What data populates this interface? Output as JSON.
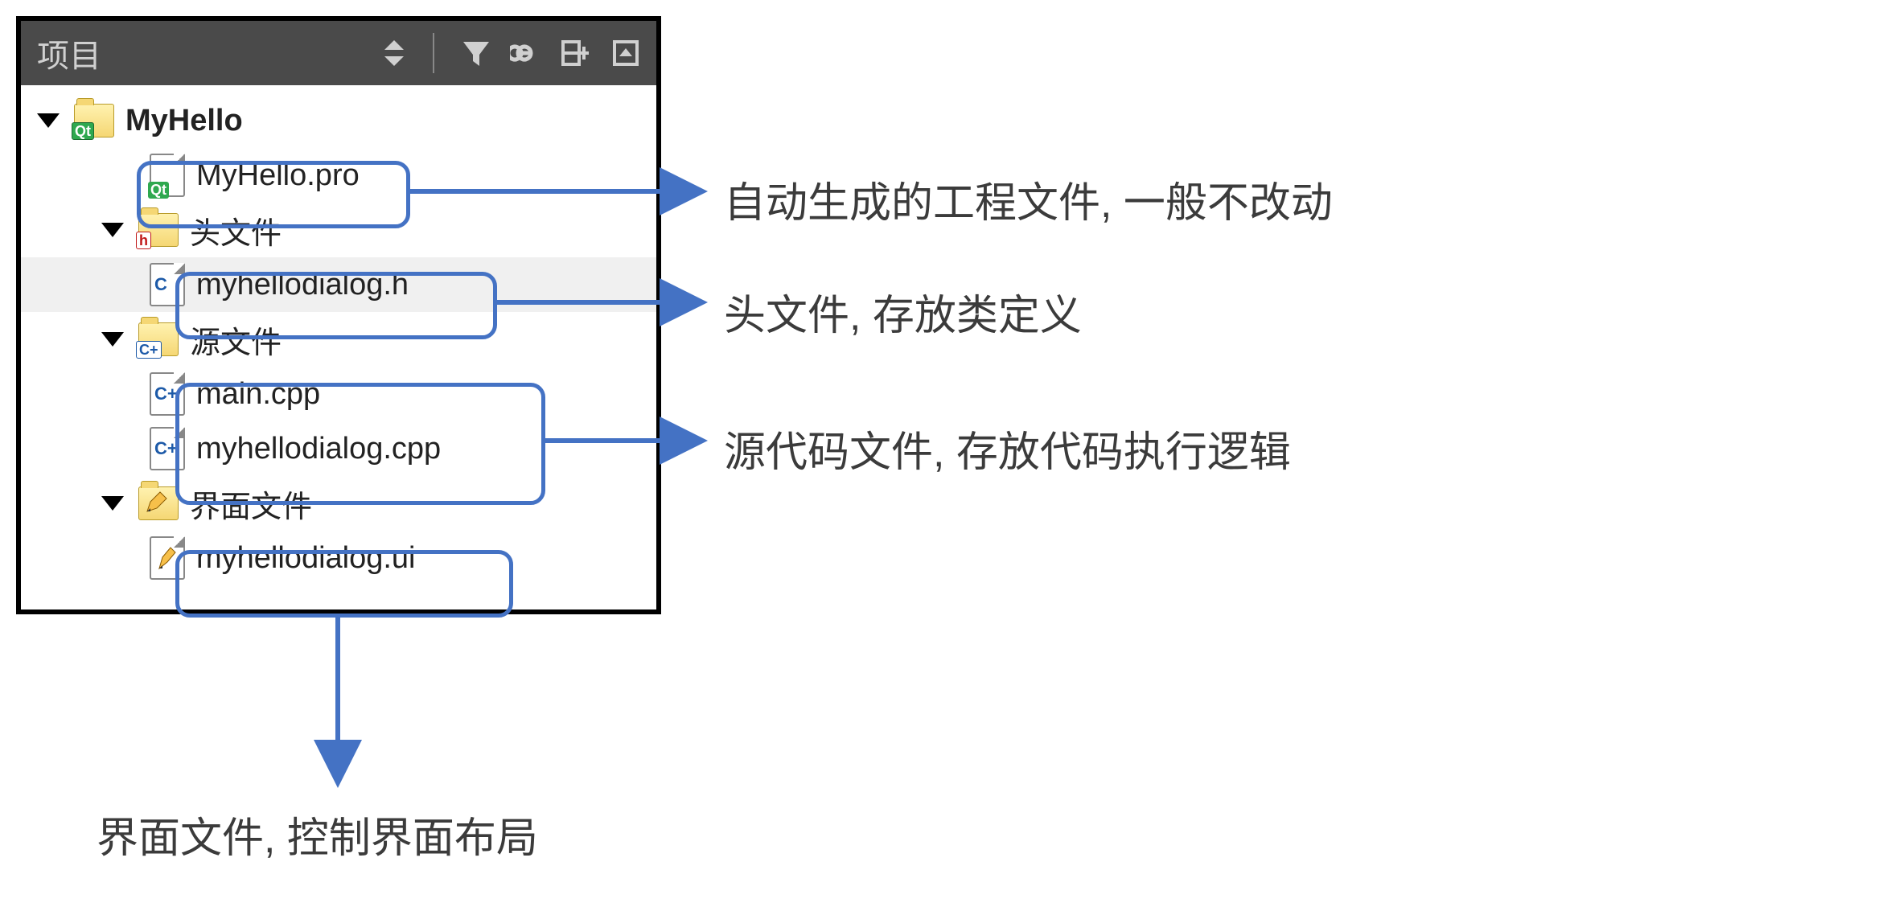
{
  "panel": {
    "title": "项目"
  },
  "tree": {
    "project": "MyHello",
    "pro_file": "MyHello.pro",
    "headers_label": "头文件",
    "header_file": "myhellodialog.h",
    "sources_label": "源文件",
    "source_main": "main.cpp",
    "source_dialog": "myhellodialog.cpp",
    "forms_label": "界面文件",
    "form_file": "myhellodialog.ui"
  },
  "annotations": {
    "pro": "自动生成的工程文件, 一般不改动",
    "header": "头文件, 存放类定义",
    "source": "源代码文件, 存放代码执行逻辑",
    "form": "界面文件, 控制界面布局"
  },
  "colors": {
    "callout": "#4472c4",
    "header_bg": "#4a4a4a"
  }
}
